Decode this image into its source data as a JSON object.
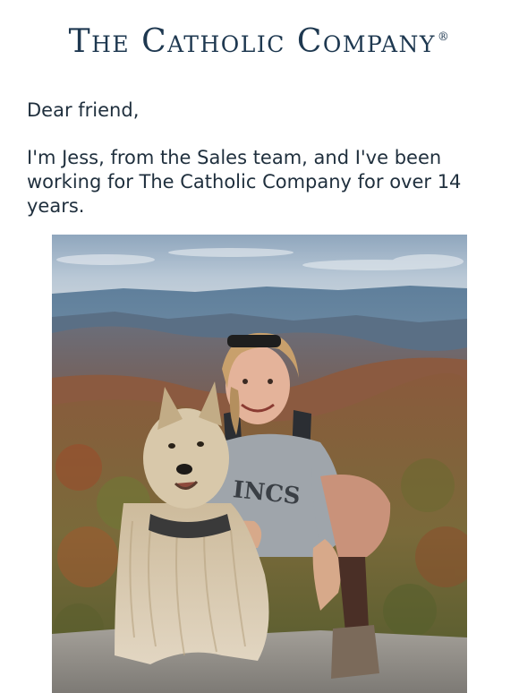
{
  "header": {
    "brand_name": "The Catholic Company",
    "registered_mark": "®"
  },
  "letter": {
    "greeting": "Dear friend,",
    "intro": "I'm Jess, from the Sales team, and I've been working for The Catholic Company for over 14 years."
  },
  "photo": {
    "shirt_text": "INCS"
  },
  "colors": {
    "brand": "#1e3850",
    "text": "#1f2f3d",
    "background": "#ffffff"
  }
}
